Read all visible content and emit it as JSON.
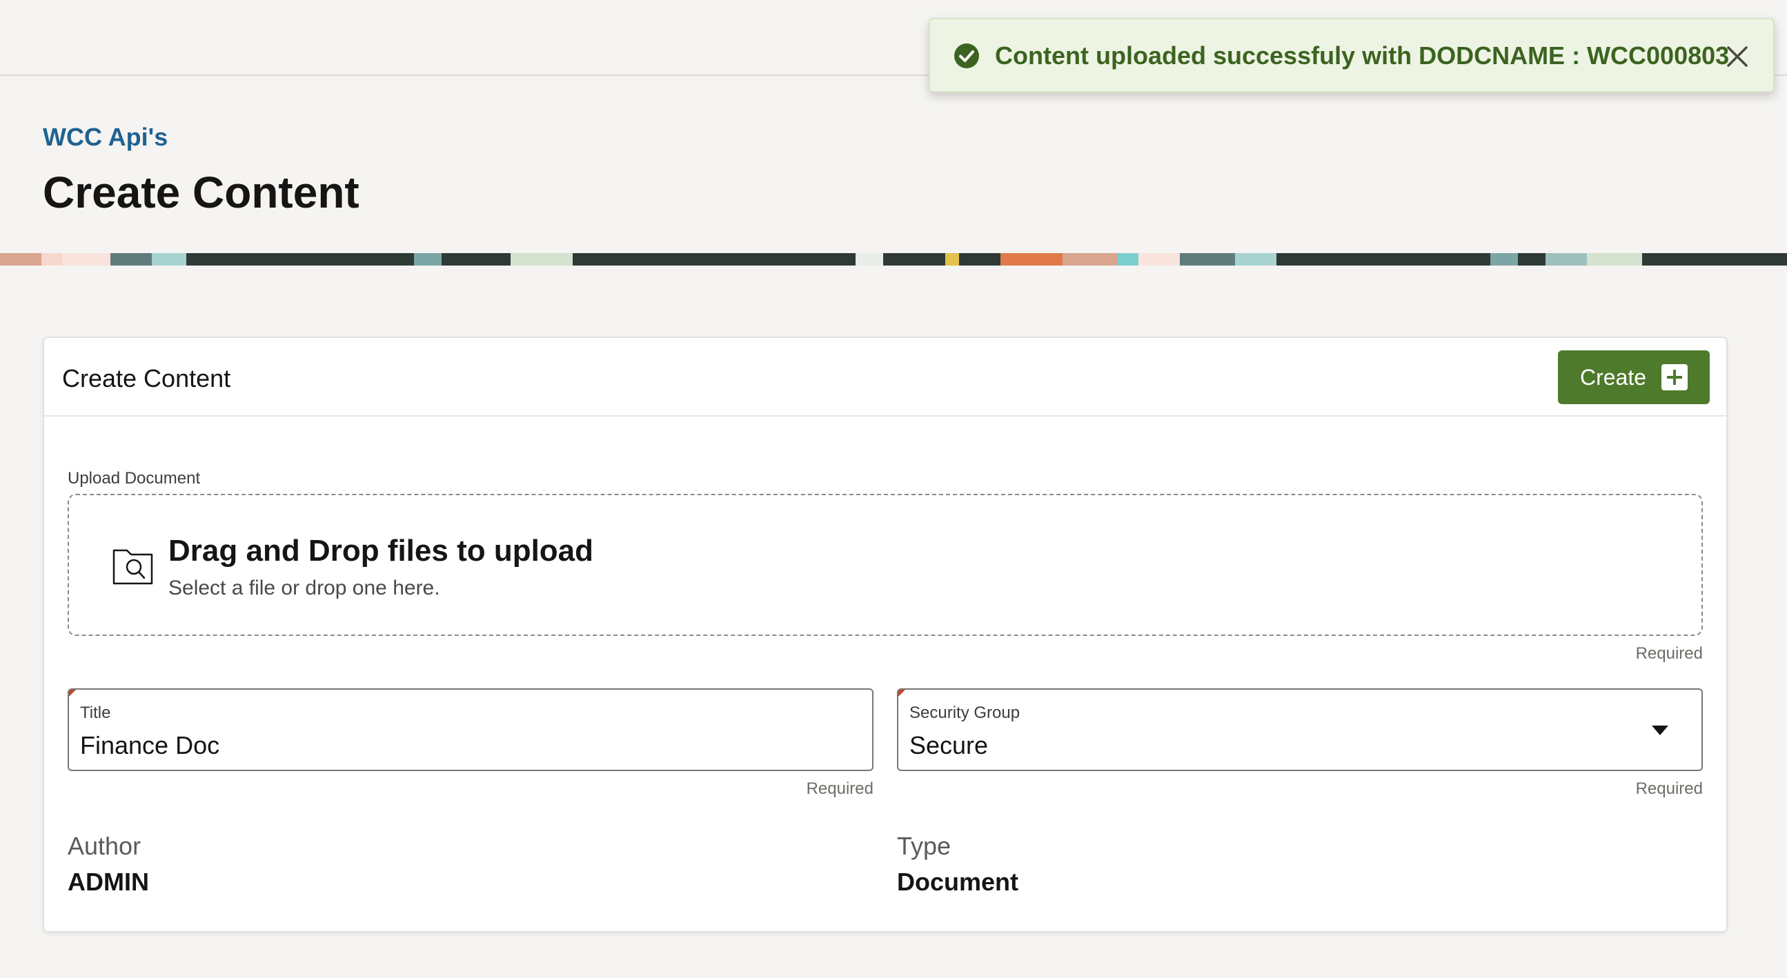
{
  "header": {
    "breadcrumb": "WCC Api's",
    "title": "Create Content"
  },
  "toast": {
    "message": "Content uploaded successfuly with DODCNAME : WCC000803",
    "status_icon": "check-circle-icon",
    "close_icon": "close-icon",
    "color": "#3b6420"
  },
  "card": {
    "title": "Create Content",
    "create_button": "Create",
    "create_icon": "plus-square-icon",
    "accent": "#4e7a2b"
  },
  "upload": {
    "label": "Upload Document",
    "title": "Drag and Drop files to upload",
    "subtitle": "Select a file or drop one here.",
    "required": "Required",
    "icon": "folder-search-icon"
  },
  "fields": {
    "title": {
      "label": "Title",
      "value": "Finance Doc",
      "required": "Required"
    },
    "security_group": {
      "label": "Security Group",
      "value": "Secure",
      "required": "Required"
    }
  },
  "readonly": {
    "author": {
      "label": "Author",
      "value": "ADMIN"
    },
    "type": {
      "label": "Type",
      "value": "Document"
    }
  }
}
